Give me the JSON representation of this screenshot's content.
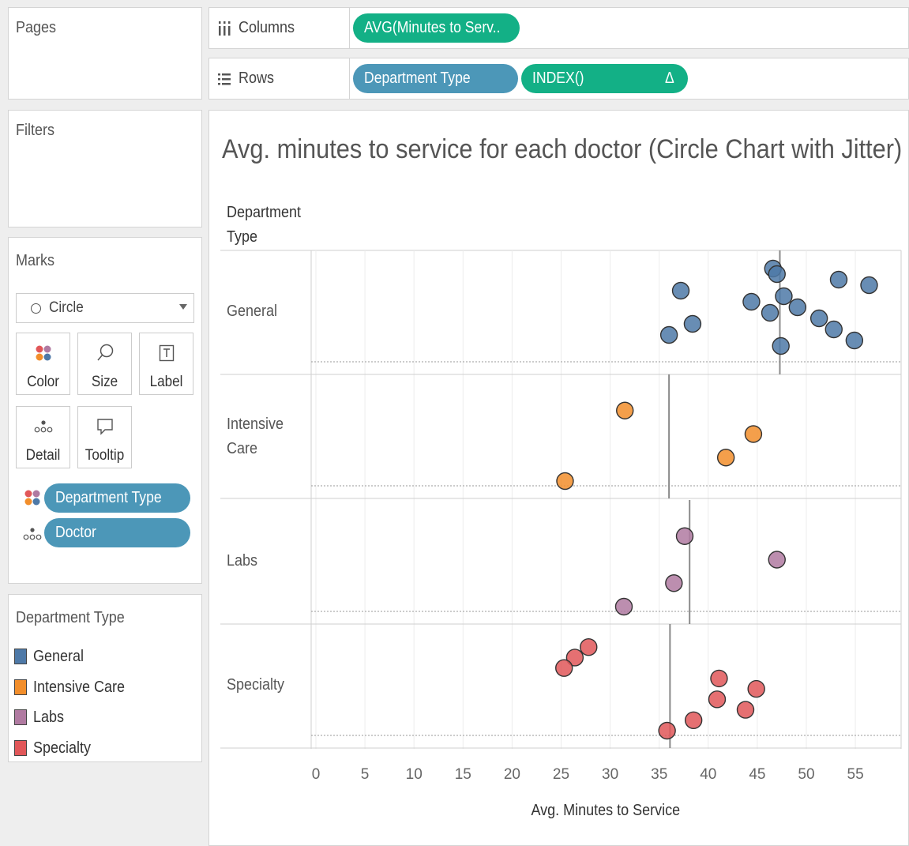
{
  "cards": {
    "pages": "Pages",
    "filters": "Filters",
    "marks": "Marks",
    "legend_title": "Department Type"
  },
  "marks": {
    "mark_type": "Circle",
    "buttons": {
      "color": "Color",
      "size": "Size",
      "label": "Label",
      "detail": "Detail",
      "tooltip": "Tooltip"
    },
    "pills": {
      "color_field": "Department Type",
      "detail_field": "Doctor"
    }
  },
  "legend": {
    "items": [
      {
        "label": "General",
        "color": "#4e79a7"
      },
      {
        "label": "Intensive Care",
        "color": "#f28e2b"
      },
      {
        "label": "Labs",
        "color": "#b07aa1"
      },
      {
        "label": "Specialty",
        "color": "#e15759"
      }
    ]
  },
  "shelves": {
    "columns_label": "Columns",
    "columns_pill": "AVG(Minutes to Serv..",
    "rows_label": "Rows",
    "rows_pill_1": "Department Type",
    "rows_pill_2": "INDEX()",
    "rows_pill_2_icon": "Δ"
  },
  "chart_data": {
    "type": "scatter",
    "title": "Avg. minutes to service for each doctor (Circle Chart with Jitter)",
    "row_header": "Department Type",
    "xlabel": "Avg. Minutes to Service",
    "xlim": [
      0,
      60
    ],
    "xticks": [
      0,
      5,
      10,
      15,
      20,
      25,
      30,
      35,
      40,
      45,
      50,
      55
    ],
    "rows": [
      {
        "name": "General",
        "label_lines": [
          "General"
        ],
        "reference_line": 47.3,
        "points": [
          [
            46.6,
            17
          ],
          [
            47.0,
            16
          ],
          [
            53.3,
            15
          ],
          [
            56.4,
            14
          ],
          [
            37.2,
            13
          ],
          [
            47.7,
            12
          ],
          [
            44.4,
            11
          ],
          [
            49.1,
            10
          ],
          [
            46.3,
            9
          ],
          [
            51.3,
            8
          ],
          [
            38.4,
            7
          ],
          [
            52.8,
            6
          ],
          [
            36.0,
            5
          ],
          [
            54.9,
            4
          ],
          [
            47.4,
            3
          ]
        ]
      },
      {
        "name": "Intensive Care",
        "label_lines": [
          "Intensive",
          "Care"
        ],
        "reference_line": 36.0,
        "points": [
          [
            31.5,
            4
          ],
          [
            44.6,
            3
          ],
          [
            41.8,
            2
          ],
          [
            25.4,
            1
          ]
        ]
      },
      {
        "name": "Labs",
        "label_lines": [
          "Labs"
        ],
        "reference_line": 38.1,
        "points": [
          [
            37.6,
            4
          ],
          [
            47.0,
            3
          ],
          [
            36.5,
            2
          ],
          [
            31.4,
            1
          ]
        ]
      },
      {
        "name": "Specialty",
        "label_lines": [
          "Specialty"
        ],
        "reference_line": 36.1,
        "points": [
          [
            27.8,
            9
          ],
          [
            26.4,
            8
          ],
          [
            25.3,
            7
          ],
          [
            41.1,
            6
          ],
          [
            44.9,
            5
          ],
          [
            40.9,
            4
          ],
          [
            43.8,
            3
          ],
          [
            38.5,
            2
          ],
          [
            35.8,
            1
          ]
        ]
      }
    ],
    "grid": "vertical",
    "legend": "left-panel"
  }
}
